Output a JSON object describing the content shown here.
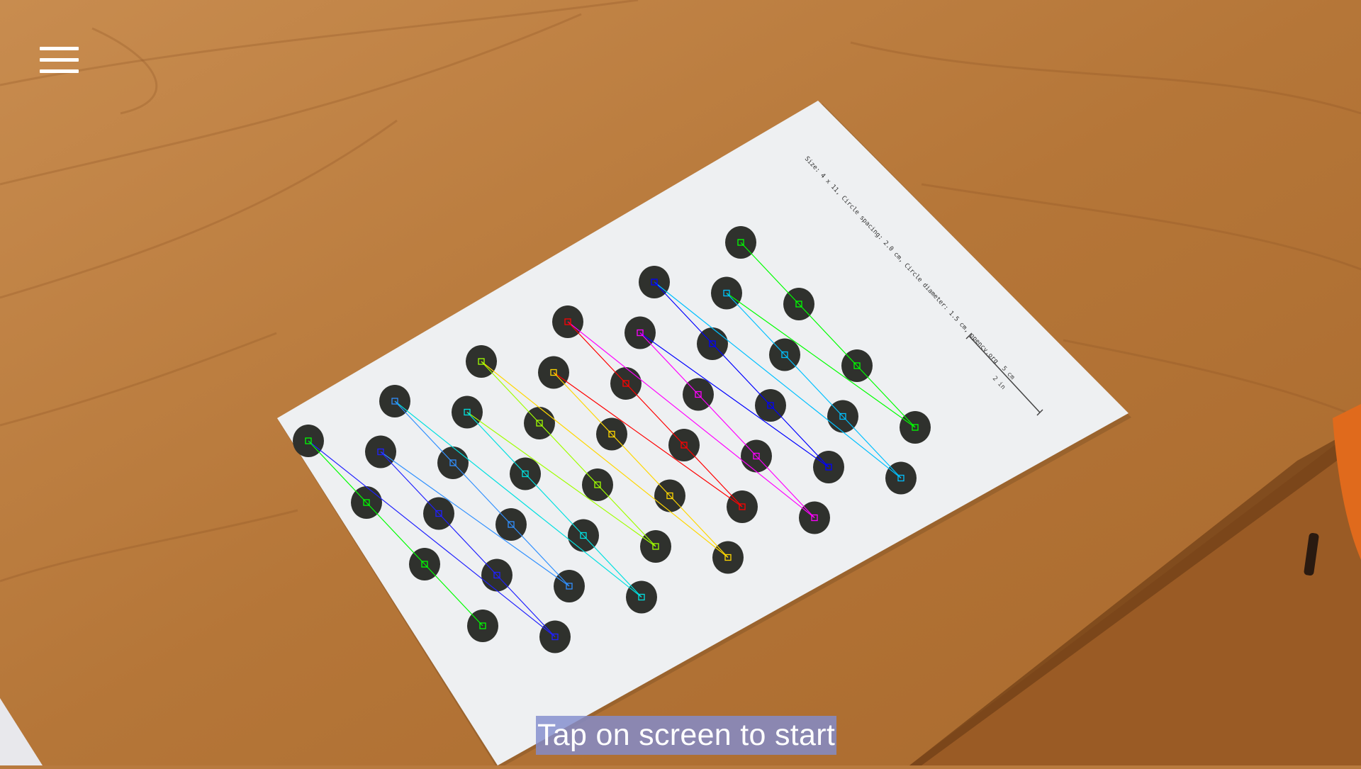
{
  "app": {
    "start_hint": "Tap on screen to start"
  },
  "icons": {
    "menu": "hamburger-menu-icon"
  },
  "target_sheet": {
    "caption": "Size: 4 x 11, Circle spacing: 2.0 cm, Circle diameter: 1.5 cm, opencv.org",
    "scale_label_cm": "5 cm",
    "scale_label_in": "2 in"
  },
  "pattern": {
    "rows": 4,
    "columns": 11
  },
  "colors": {
    "wood": "#b87a3e",
    "paper": "#eef0f2",
    "dot": "#2f312d",
    "hint_background": "#828ccd",
    "hint_text": "#ffffff",
    "detection_lines": [
      "#00ff00",
      "#00c0ff",
      "#0000ff",
      "#ff00ff",
      "#ff0000",
      "#ffd700",
      "#a0ff00",
      "#00e0e0",
      "#3090ff",
      "#2020ff"
    ]
  }
}
